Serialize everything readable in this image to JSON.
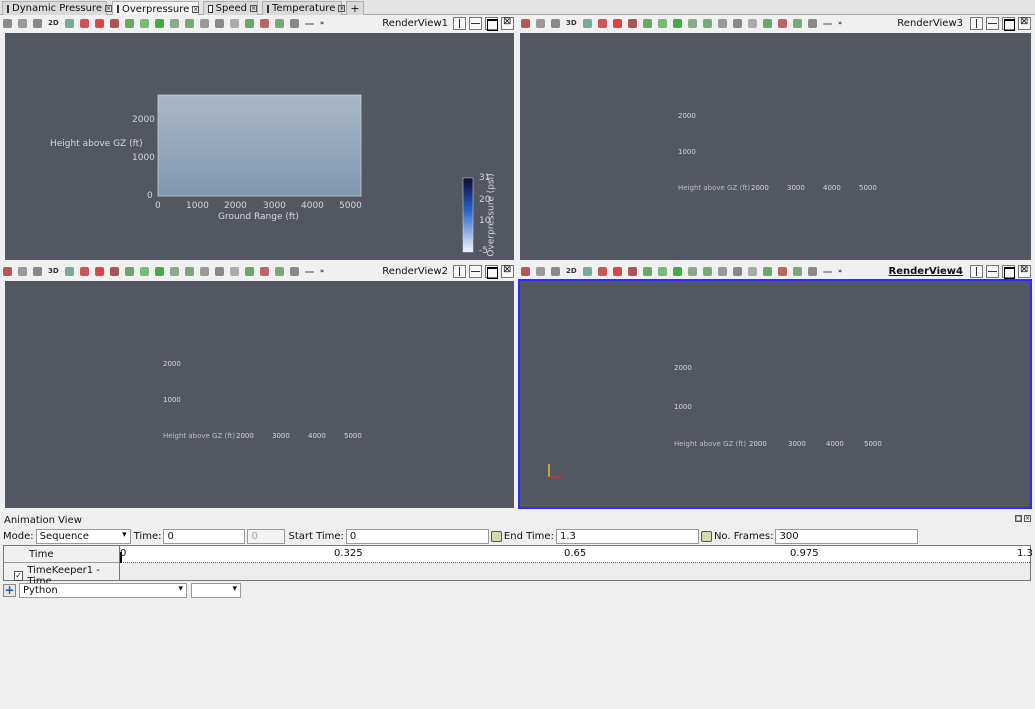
{
  "tabs": [
    {
      "label": "Dynamic Pressure",
      "active": false
    },
    {
      "label": "Overpressure",
      "active": true
    },
    {
      "label": "Speed",
      "active": false
    },
    {
      "label": "Temperature",
      "active": false
    },
    {
      "label": "+",
      "active": false
    }
  ],
  "views": {
    "v1": {
      "title": "RenderView1",
      "mode": "2D"
    },
    "v2": {
      "title": "RenderView2",
      "mode": "3D"
    },
    "v3": {
      "title": "RenderView3",
      "mode": "3D"
    },
    "v4": {
      "title": "RenderView4",
      "mode": "2D"
    }
  },
  "plot": {
    "y_ticks": [
      "2000",
      "1000",
      "0"
    ],
    "x_ticks": [
      "0",
      "1000",
      "2000",
      "3000",
      "4000",
      "5000"
    ],
    "ylabel": "Height above GZ (ft)",
    "xlabel": "Ground Range (ft)",
    "colorbar": {
      "title": "Overpressure (psi)",
      "ticks": [
        "31",
        "20",
        "10",
        "-5"
      ],
      "colors": [
        "#0a0a30",
        "#2a66cc",
        "#f0f4fa"
      ]
    }
  },
  "ghost": {
    "y_ticks": [
      "2000",
      "1000"
    ],
    "overlap_text": "Height above GZ (ft)",
    "x_ticks": [
      "2000",
      "3000",
      "4000",
      "5000"
    ]
  },
  "colors": {
    "view_bg": "#525762",
    "plane": "#8fa7bd",
    "selected_border": "#2c2cff"
  },
  "animation": {
    "title": "Animation View",
    "mode_label": "Mode:",
    "mode_value": "Sequence",
    "time_label": "Time:",
    "time_value": "0",
    "time_index": "0",
    "start_label": "Start Time:",
    "start_value": "0",
    "end_label": "End Time:",
    "end_value": "1.3",
    "frames_label": "No. Frames:",
    "frames_value": "300",
    "time_col": "Time",
    "ticks": [
      "0",
      "0.325",
      "0.65",
      "0.975",
      "1.3"
    ],
    "track": "TimeKeeper1 - Time",
    "python": "Python",
    "python_extra": ""
  }
}
